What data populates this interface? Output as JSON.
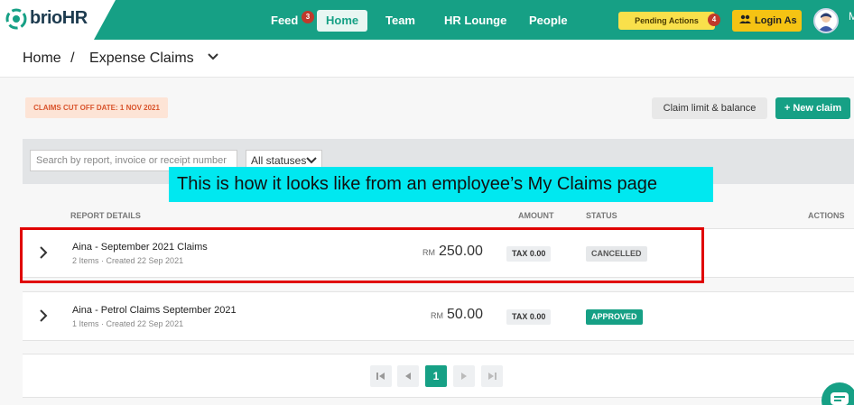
{
  "brand": {
    "name_main": "brio",
    "name_suffix": "HR",
    "accent": "#16a085"
  },
  "nav": {
    "feed": "Feed",
    "feed_badge": "3",
    "home": "Home",
    "team": "Team",
    "hr_lounge": "HR Lounge",
    "people": "People",
    "pending_actions": "Pending Actions",
    "pending_badge": "4",
    "login_as": "Login As",
    "overflow_letter": "M"
  },
  "breadcrumb": {
    "home": "Home",
    "separator": "/",
    "current": "Expense Claims"
  },
  "toolbar": {
    "cutoff_label": "CLAIMS CUT OFF DATE: 1 NOV 2021",
    "claim_limit_button": "Claim limit & balance",
    "new_claim_button": "+ New claim"
  },
  "filters": {
    "search_placeholder": "Search by report, invoice or receipt number",
    "status_selected": "All statuses"
  },
  "annotation": {
    "callout_text": "This is how it looks like from an employee’s My Claims page"
  },
  "table": {
    "headers": {
      "details": "REPORT DETAILS",
      "amount": "AMOUNT",
      "status": "STATUS",
      "actions": "ACTIONS"
    },
    "rows": [
      {
        "title": "Aina - September 2021 Claims",
        "meta": "2 Items · Created 22 Sep 2021",
        "currency": "RM",
        "amount": "250.00",
        "tax": "TAX 0.00",
        "status": "CANCELLED"
      },
      {
        "title": "Aina - Petrol Claims September 2021",
        "meta": "1 Items · Created 22 Sep 2021",
        "currency": "RM",
        "amount": "50.00",
        "tax": "TAX 0.00",
        "status": "APPROVED"
      }
    ]
  },
  "pagination": {
    "current_page": "1"
  }
}
